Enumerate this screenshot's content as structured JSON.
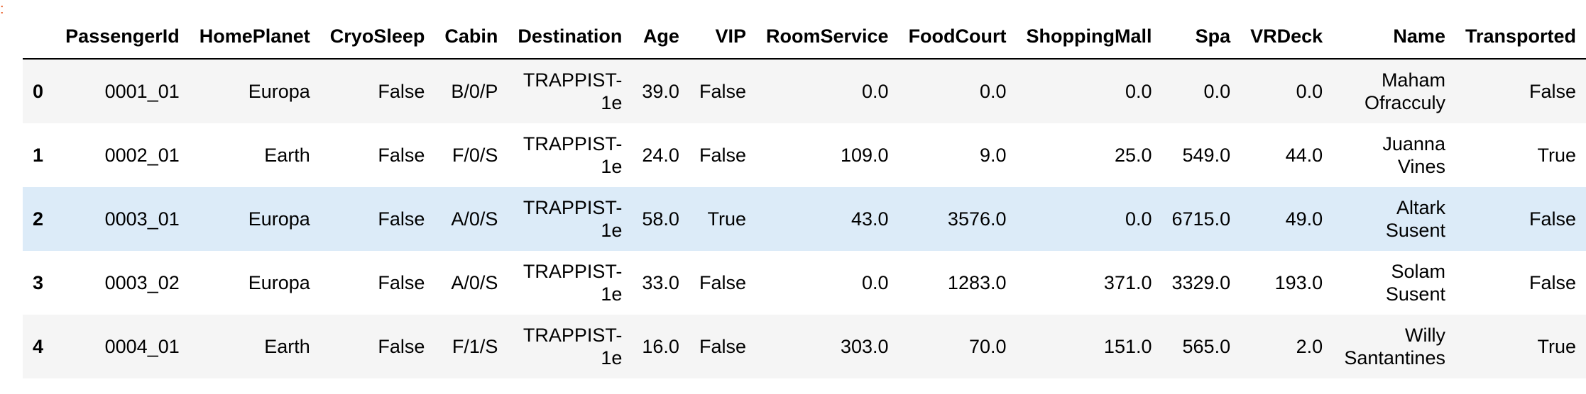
{
  "marker": ":",
  "table": {
    "columns": [
      "",
      "PassengerId",
      "HomePlanet",
      "CryoSleep",
      "Cabin",
      "Destination",
      "Age",
      "VIP",
      "RoomService",
      "FoodCourt",
      "ShoppingMall",
      "Spa",
      "VRDeck",
      "Name",
      "Transported"
    ],
    "rows": [
      {
        "index": "0",
        "PassengerId": "0001_01",
        "HomePlanet": "Europa",
        "CryoSleep": "False",
        "Cabin": "B/0/P",
        "Destination": "TRAPPIST-1e",
        "Age": "39.0",
        "VIP": "False",
        "RoomService": "0.0",
        "FoodCourt": "0.0",
        "ShoppingMall": "0.0",
        "Spa": "0.0",
        "VRDeck": "0.0",
        "Name": "Maham Ofracculy",
        "Transported": "False"
      },
      {
        "index": "1",
        "PassengerId": "0002_01",
        "HomePlanet": "Earth",
        "CryoSleep": "False",
        "Cabin": "F/0/S",
        "Destination": "TRAPPIST-1e",
        "Age": "24.0",
        "VIP": "False",
        "RoomService": "109.0",
        "FoodCourt": "9.0",
        "ShoppingMall": "25.0",
        "Spa": "549.0",
        "VRDeck": "44.0",
        "Name": "Juanna Vines",
        "Transported": "True"
      },
      {
        "index": "2",
        "PassengerId": "0003_01",
        "HomePlanet": "Europa",
        "CryoSleep": "False",
        "Cabin": "A/0/S",
        "Destination": "TRAPPIST-1e",
        "Age": "58.0",
        "VIP": "True",
        "RoomService": "43.0",
        "FoodCourt": "3576.0",
        "ShoppingMall": "0.0",
        "Spa": "6715.0",
        "VRDeck": "49.0",
        "Name": "Altark Susent",
        "Transported": "False"
      },
      {
        "index": "3",
        "PassengerId": "0003_02",
        "HomePlanet": "Europa",
        "CryoSleep": "False",
        "Cabin": "A/0/S",
        "Destination": "TRAPPIST-1e",
        "Age": "33.0",
        "VIP": "False",
        "RoomService": "0.0",
        "FoodCourt": "1283.0",
        "ShoppingMall": "371.0",
        "Spa": "3329.0",
        "VRDeck": "193.0",
        "Name": "Solam Susent",
        "Transported": "False"
      },
      {
        "index": "4",
        "PassengerId": "0004_01",
        "HomePlanet": "Earth",
        "CryoSleep": "False",
        "Cabin": "F/1/S",
        "Destination": "TRAPPIST-1e",
        "Age": "16.0",
        "VIP": "False",
        "RoomService": "303.0",
        "FoodCourt": "70.0",
        "ShoppingMall": "151.0",
        "Spa": "565.0",
        "VRDeck": "2.0",
        "Name": "Willy Santantines",
        "Transported": "True"
      }
    ],
    "highlighted_row": 2
  },
  "colors": {
    "highlight": "#dcebf8",
    "stripe": "#f5f5f5",
    "marker": "#e8571f"
  }
}
